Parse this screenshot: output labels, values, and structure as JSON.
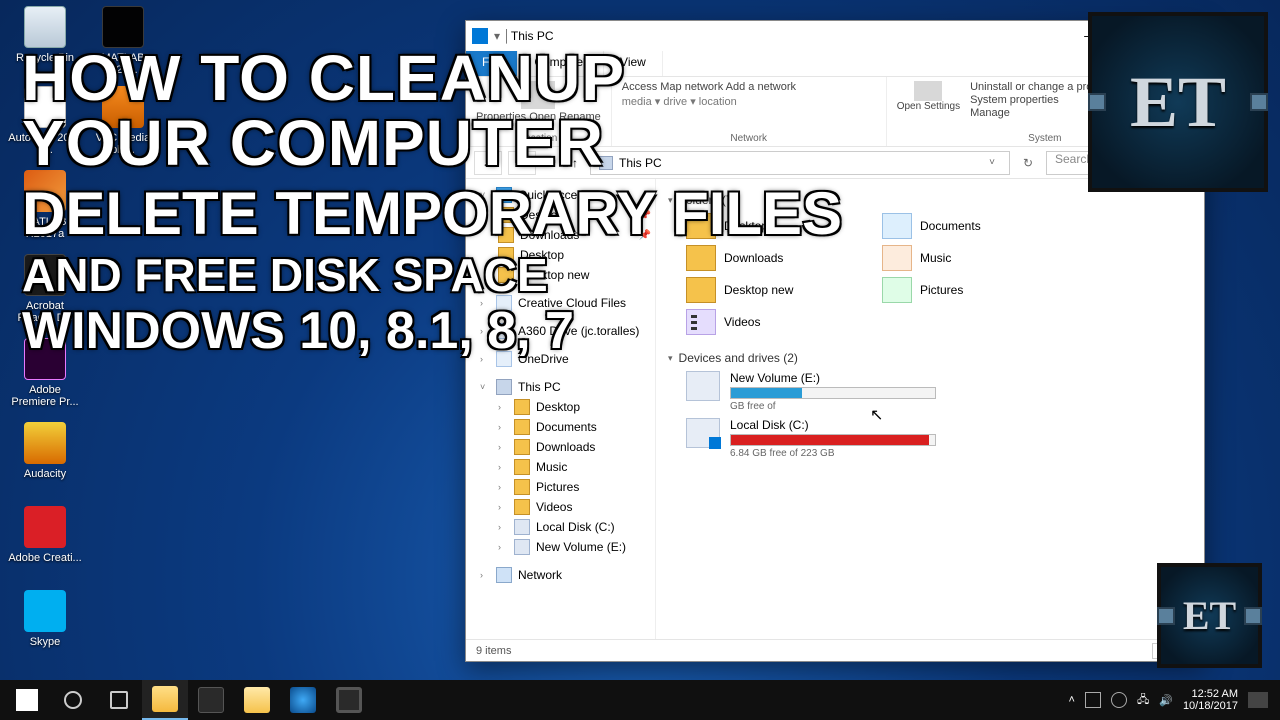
{
  "desktop_icons": {
    "recycle": "Recycle Bin",
    "matlab_b": "MATLAB R20...",
    "autocad": "AutoCAD 2017 - ...",
    "vlc": "VLC media pla...",
    "matlab_a": "MATLAB R2017a",
    "acrobat": "Acrobat Reader DC",
    "premiere": "Adobe Premiere Pr...",
    "audacity": "Audacity",
    "creative": "Adobe Creati...",
    "skype": "Skype"
  },
  "overlay": {
    "line1": "HOW TO CLEANUP",
    "line2": "YOUR COMPUTER",
    "line3": "DELETE TEMPORARY FILES",
    "line4": "AND FREE DISK SPACE",
    "line5": "WINDOWS 10, 8.1, 8, 7"
  },
  "et_badge": "ET",
  "explorer": {
    "title": "This PC",
    "tabs": {
      "file": "File",
      "computer": "Computer",
      "view": "View"
    },
    "ribbon": {
      "g1_lines": "Properties  Open  Rename",
      "g1_cap": "Location",
      "g2_lines": "Access  Map network  Add a network",
      "g2_sub": "media ▾    drive ▾       location",
      "g2_cap": "Network",
      "g3_a": "Uninstall or change a program",
      "g3_b": "System properties",
      "g3_c": "Manage",
      "g3_open": "Open Settings",
      "g3_cap": "System"
    },
    "address": "This PC",
    "search_placeholder": "Search Thi...",
    "sidebar": {
      "quick": "Quick access",
      "desktop": "Desktop",
      "downloads": "Downloads",
      "desktop2": "Desktop",
      "desktop_new": "Desktop new",
      "ccf": "Creative Cloud Files",
      "a360": "A360 Drive (jc.toralles)",
      "onedrive": "OneDrive",
      "thispc": "This PC",
      "sub_desktop": "Desktop",
      "sub_documents": "Documents",
      "sub_downloads": "Downloads",
      "sub_music": "Music",
      "sub_pictures": "Pictures",
      "sub_videos": "Videos",
      "sub_c": "Local Disk (C:)",
      "sub_e": "New Volume (E:)",
      "network": "Network"
    },
    "content": {
      "section_folders": "Folders (7)",
      "desktop": "Desktop",
      "documents": "Documents",
      "downloads": "Downloads",
      "music": "Music",
      "pictures": "Pictures",
      "videos": "Videos",
      "desktop_new": "Desktop new",
      "section_devices": "Devices and drives (2)",
      "drive_c_name": "Local Disk (C:)",
      "drive_c_sub": "6.84 GB free of 223 GB",
      "drive_c_fill_pct": 97,
      "drive_e_name": "New Volume (E:)",
      "drive_e_sub": "GB free of",
      "drive_e_fill_pct": 35
    },
    "status": "9 items"
  },
  "taskbar": {
    "time": "12:52 AM",
    "date": "10/18/2017"
  }
}
